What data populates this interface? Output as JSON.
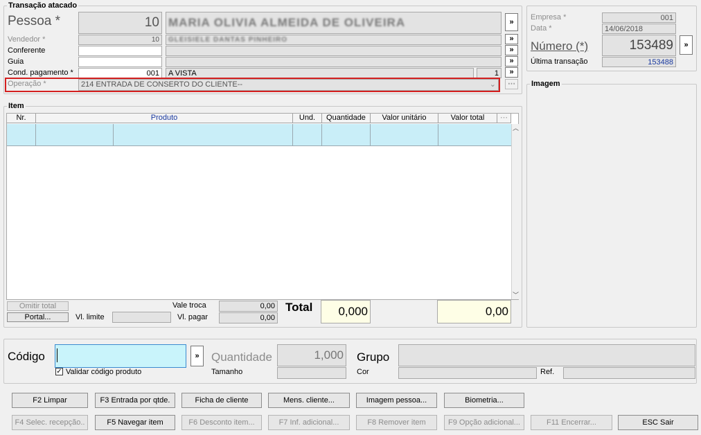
{
  "header_group": {
    "title": "Transação atacado"
  },
  "pessoa": {
    "label": "Pessoa *",
    "code": "10",
    "name": "MARIA OLIVIA ALMEIDA DE OLIVEIRA"
  },
  "vendedor": {
    "label": "Vendedor *",
    "code": "10",
    "name": "GLEISIELE DANTAS PINHEIRO"
  },
  "conferente": {
    "label": "Conferente",
    "code": "",
    "name": ""
  },
  "guia": {
    "label": "Guia",
    "code": "",
    "name": ""
  },
  "cond_pagamento": {
    "label": "Cond. pagamento *",
    "code": "001",
    "name": "A VISTA",
    "parcelas": "1"
  },
  "operacao": {
    "label": "Operação *",
    "value": "214 ENTRADA DE CONSERTO DO CLIENTE--"
  },
  "more_button": "»",
  "company": {
    "empresa_label": "Empresa *",
    "empresa_value": "001",
    "data_label": "Data *",
    "data_value": "14/06/2018",
    "numero_label": "Número (*)",
    "numero_value": "153489",
    "ultima_label": "Última transação",
    "ultima_value": "153488"
  },
  "imagem": {
    "title": "Imagem"
  },
  "item": {
    "title": "Item",
    "columns": [
      "Nr.",
      "Produto",
      "Und.",
      "Quantidade",
      "Valor unitário",
      "Valor total"
    ],
    "omitir_total": "Omitir total",
    "portal": "Portal...",
    "vl_limite_label": "Vl. limite",
    "vale_troca_label": "Vale troca",
    "vale_troca_value": "0,00",
    "vl_pagar_label": "Vl. pagar",
    "vl_pagar_value": "0,00",
    "total_label": "Total",
    "total_qty": "0,000",
    "total_value": "0,00"
  },
  "codigo": {
    "label": "Código",
    "value": "",
    "validar_label": "Validar código produto",
    "validar_checked": true
  },
  "quantidade": {
    "label": "Quantidade",
    "value": "1,000"
  },
  "tamanho_label": "Tamanho",
  "grupo_label": "Grupo",
  "cor_label": "Cor",
  "ref_label": "Ref.",
  "buttons_row1": [
    "F2 Limpar",
    "F3 Entrada por qtde.",
    "Ficha de cliente",
    "Mens. cliente...",
    "Imagem pessoa...",
    "Biometria..."
  ],
  "buttons_row2": [
    "F4 Selec. recepção..",
    "F5 Navegar item",
    "F6 Desconto item...",
    "F7 Inf. adicional...",
    "F8 Remover item",
    "F9 Opção adicional...",
    "F11 Encerrar...",
    "ESC Sair"
  ]
}
